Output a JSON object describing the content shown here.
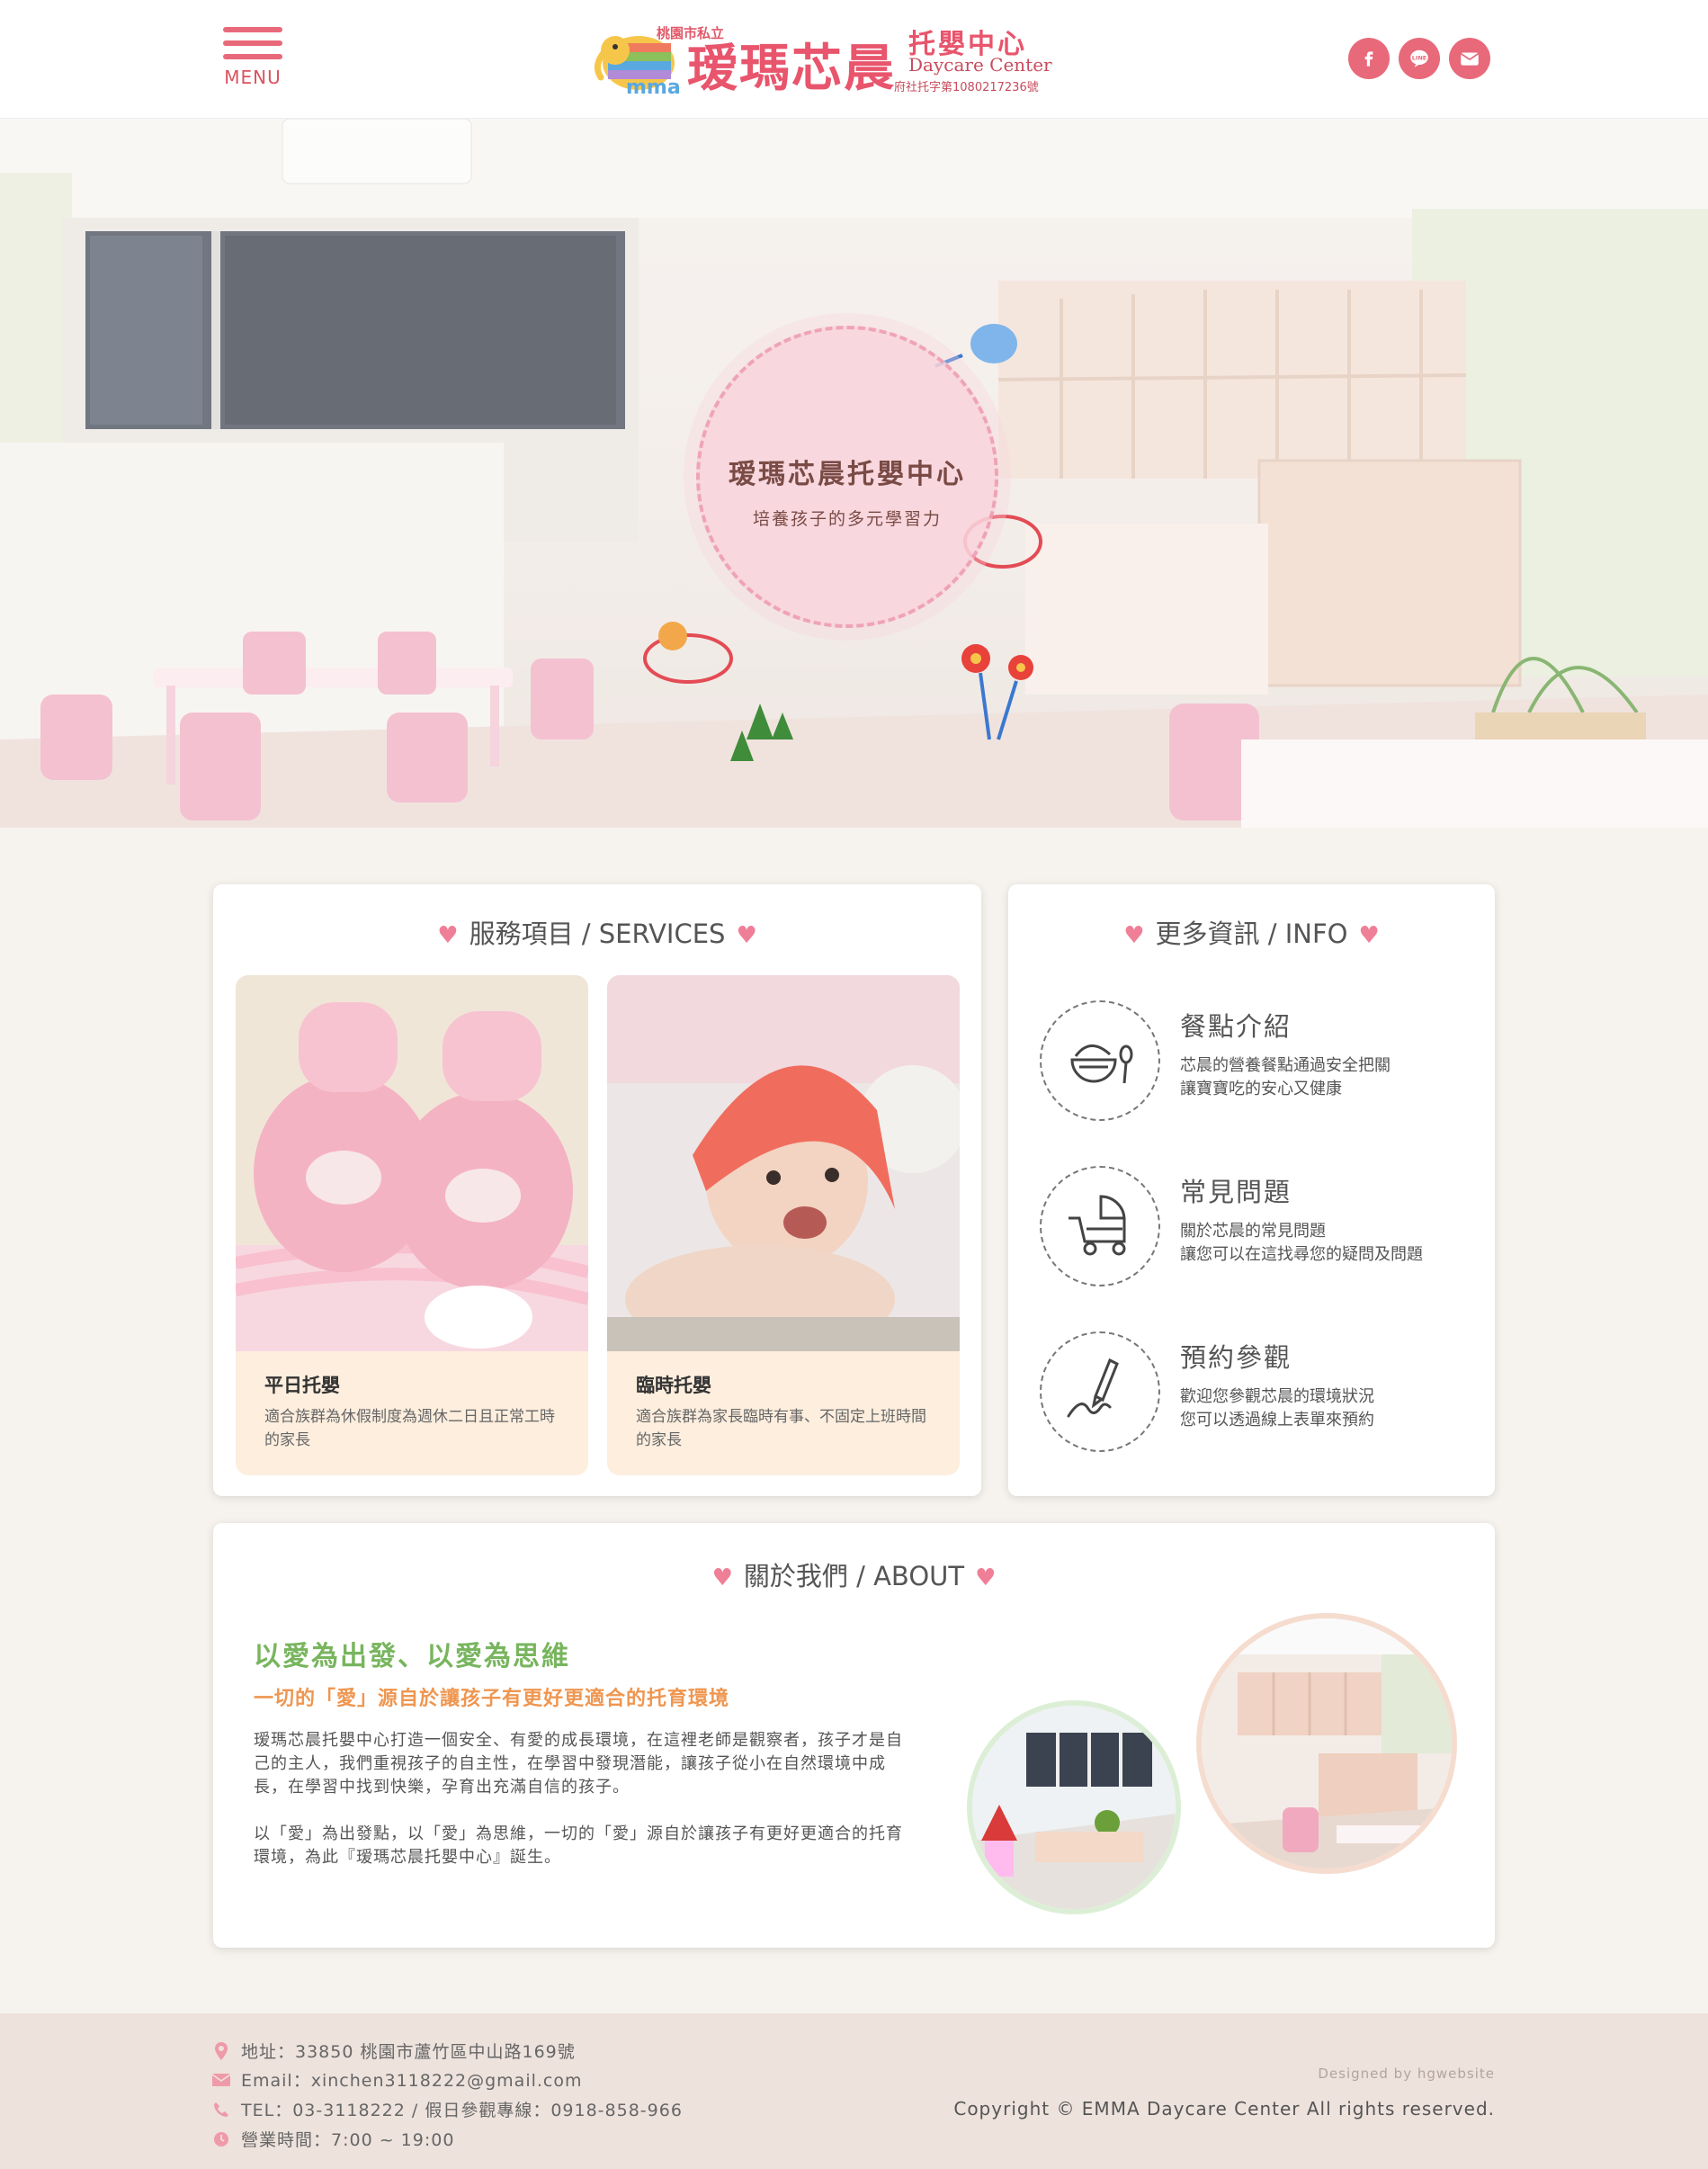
{
  "header": {
    "menu_label": "MENU",
    "logo": {
      "city": "桃園市私立",
      "name": "瑷瑪芯晨",
      "sub_cn": "托嬰中心",
      "sub_en": "Daycare Center",
      "registration": "府社托字第1080217236號"
    },
    "socials": [
      {
        "icon": "facebook-icon"
      },
      {
        "icon": "line-icon"
      },
      {
        "icon": "mail-icon"
      }
    ]
  },
  "hero": {
    "title": "瑷瑪芯晨托嬰中心",
    "subtitle": "培養孩子的多元學習力"
  },
  "services": {
    "heading": "服務項目 / SERVICES",
    "items": [
      {
        "title": "平日托嬰",
        "desc": "適合族群為休假制度為週休二日且正常工時的家長"
      },
      {
        "title": "臨時托嬰",
        "desc": "適合族群為家長臨時有事、不固定上班時間的家長"
      }
    ]
  },
  "info": {
    "heading": "更多資訊 / INFO",
    "items": [
      {
        "icon": "rice-bowl-icon",
        "title": "餐點介紹",
        "desc1": "芯晨的營養餐點通過安全把關",
        "desc2": "讓寶寶吃的安心又健康"
      },
      {
        "icon": "stroller-icon",
        "title": "常見問題",
        "desc1": "關於芯晨的常見問題",
        "desc2": "讓您可以在這找尋您的疑問及問題"
      },
      {
        "icon": "pen-sign-icon",
        "title": "預約參觀",
        "desc1": "歡迎您參觀芯晨的環境狀況",
        "desc2": "您可以透過線上表單來預約"
      }
    ]
  },
  "about": {
    "heading": "關於我們 / ABOUT",
    "headline": "以愛為出發、以愛為思維",
    "tagline": "一切的「愛」源自於讓孩子有更好更適合的托育環境",
    "para1": "瑷瑪芯晨托嬰中心打造一個安全、有愛的成長環境，在這裡老師是觀察者，孩子才是自己的主人，我們重視孩子的自主性，在學習中發現潛能，讓孩子從小在自然環境中成長，在學習中找到快樂，孕育出充滿自信的孩子。",
    "para2": "以「愛」為出發點，以「愛」為思維，一切的「愛」源自於讓孩子有更好更適合的托育環境，為此『瑷瑪芯晨托嬰中心』誕生。"
  },
  "footer": {
    "address": "地址：33850 桃園市蘆竹區中山路169號",
    "email": "Email：xinchen3118222@gmail.com",
    "tel": "TEL：03-3118222 / 假日參觀專線：0918-858-966",
    "hours": "營業時間：7:00 ~ 19:00",
    "designed": "Designed by hgwebsite",
    "copyright": "Copyright © EMMA Daycare Center All rights reserved."
  }
}
